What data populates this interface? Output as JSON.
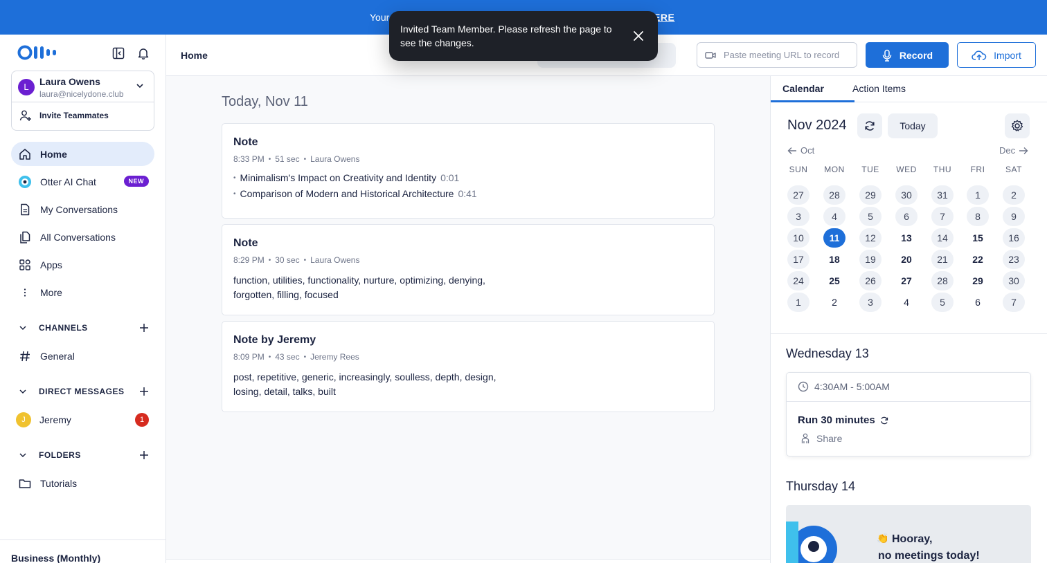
{
  "banner": {
    "left_text": "Your",
    "right_text": "ERE"
  },
  "toast": {
    "message": "Invited Team Member. Please refresh the page to see the changes."
  },
  "sidebar": {
    "account": {
      "initial": "L",
      "name": "Laura Owens",
      "email": "laura@nicelydone.club",
      "invite_label": "Invite Teammates"
    },
    "nav": [
      {
        "label": "Home",
        "icon": "home-icon",
        "active": true
      },
      {
        "label": "Otter AI Chat",
        "icon": "otter-chat-icon",
        "badge": "NEW"
      },
      {
        "label": "My Conversations",
        "icon": "document-icon"
      },
      {
        "label": "All Conversations",
        "icon": "documents-icon"
      },
      {
        "label": "Apps",
        "icon": "apps-grid-icon"
      },
      {
        "label": "More",
        "icon": "more-vertical-icon"
      }
    ],
    "channels": {
      "title": "CHANNELS",
      "items": [
        {
          "label": "General",
          "icon": "hash-icon"
        }
      ]
    },
    "direct_messages": {
      "title": "DIRECT MESSAGES",
      "items": [
        {
          "initial": "J",
          "label": "Jeremy",
          "unread": "1"
        }
      ]
    },
    "folders": {
      "title": "FOLDERS",
      "items": [
        {
          "label": "Tutorials",
          "icon": "folder-icon"
        }
      ]
    },
    "plan": "Business (Monthly)"
  },
  "header": {
    "title": "Home",
    "url_placeholder": "Paste meeting URL to record",
    "record_label": "Record",
    "import_label": "Import"
  },
  "main": {
    "date_heading": "Today, Nov 11",
    "notes": [
      {
        "title": "Note",
        "time": "8:33 PM",
        "duration": "51 sec",
        "author": "Laura Owens",
        "outline": [
          {
            "text": "Minimalism's Impact on Creativity and Identity",
            "ts": "0:01"
          },
          {
            "text": "Comparison of Modern and Historical Architecture",
            "ts": "0:41"
          }
        ]
      },
      {
        "title": "Note",
        "time": "8:29 PM",
        "duration": "30 sec",
        "author": "Laura Owens",
        "keywords": "function, utilities, functionality, nurture, optimizing, denying, forgotten, filling, focused"
      },
      {
        "title": "Note by Jeremy",
        "time": "8:09 PM",
        "duration": "43 sec",
        "author": "Jeremy Rees",
        "keywords": "post, repetitive, generic, increasingly, soulless, depth, design, losing, detail, talks, built"
      }
    ]
  },
  "calendar": {
    "tabs": [
      "Calendar",
      "Action Items"
    ],
    "month_title": "Nov 2024",
    "today_label": "Today",
    "prev_label": "Oct",
    "next_label": "Dec",
    "weekdays": [
      "SUN",
      "MON",
      "TUE",
      "WED",
      "THU",
      "FRI",
      "SAT"
    ],
    "weeks": [
      [
        {
          "d": "27",
          "s": 1
        },
        {
          "d": "28",
          "s": 1
        },
        {
          "d": "29",
          "s": 1
        },
        {
          "d": "30",
          "s": 1
        },
        {
          "d": "31",
          "s": 1
        },
        {
          "d": "1",
          "s": 1
        },
        {
          "d": "2",
          "s": 1
        }
      ],
      [
        {
          "d": "3",
          "s": 1
        },
        {
          "d": "4",
          "s": 1
        },
        {
          "d": "5",
          "s": 1
        },
        {
          "d": "6",
          "s": 1
        },
        {
          "d": "7",
          "s": 1
        },
        {
          "d": "8",
          "s": 1
        },
        {
          "d": "9",
          "s": 1
        }
      ],
      [
        {
          "d": "10",
          "s": 1
        },
        {
          "d": "11",
          "sel": 1
        },
        {
          "d": "12",
          "s": 1
        },
        {
          "d": "13",
          "b": 1
        },
        {
          "d": "14",
          "s": 1
        },
        {
          "d": "15",
          "b": 1
        },
        {
          "d": "16",
          "s": 1
        }
      ],
      [
        {
          "d": "17",
          "s": 1
        },
        {
          "d": "18",
          "b": 1
        },
        {
          "d": "19",
          "s": 1
        },
        {
          "d": "20",
          "b": 1
        },
        {
          "d": "21",
          "s": 1
        },
        {
          "d": "22",
          "b": 1
        },
        {
          "d": "23",
          "s": 1
        }
      ],
      [
        {
          "d": "24",
          "s": 1
        },
        {
          "d": "25",
          "b": 1
        },
        {
          "d": "26",
          "s": 1
        },
        {
          "d": "27",
          "b": 1
        },
        {
          "d": "28",
          "s": 1
        },
        {
          "d": "29",
          "b": 1
        },
        {
          "d": "30",
          "s": 1
        }
      ],
      [
        {
          "d": "1",
          "s": 1
        },
        {
          "d": "2"
        },
        {
          "d": "3",
          "s": 1
        },
        {
          "d": "4"
        },
        {
          "d": "5",
          "s": 1
        },
        {
          "d": "6"
        },
        {
          "d": "7",
          "s": 1
        }
      ]
    ],
    "agenda": [
      {
        "day": "Wednesday 13",
        "event": {
          "time": "4:30AM - 5:00AM",
          "title": "Run 30 minutes",
          "share_label": "Share"
        }
      },
      {
        "day": "Thursday 14",
        "empty_line1": "Hooray,",
        "empty_line2": "no meetings today!"
      }
    ]
  },
  "colors": {
    "brand_blue": "#1e6fd9",
    "badge_purple": "#6b1fd1",
    "unread_red": "#d62b1f",
    "toast_bg": "#1e2128"
  }
}
